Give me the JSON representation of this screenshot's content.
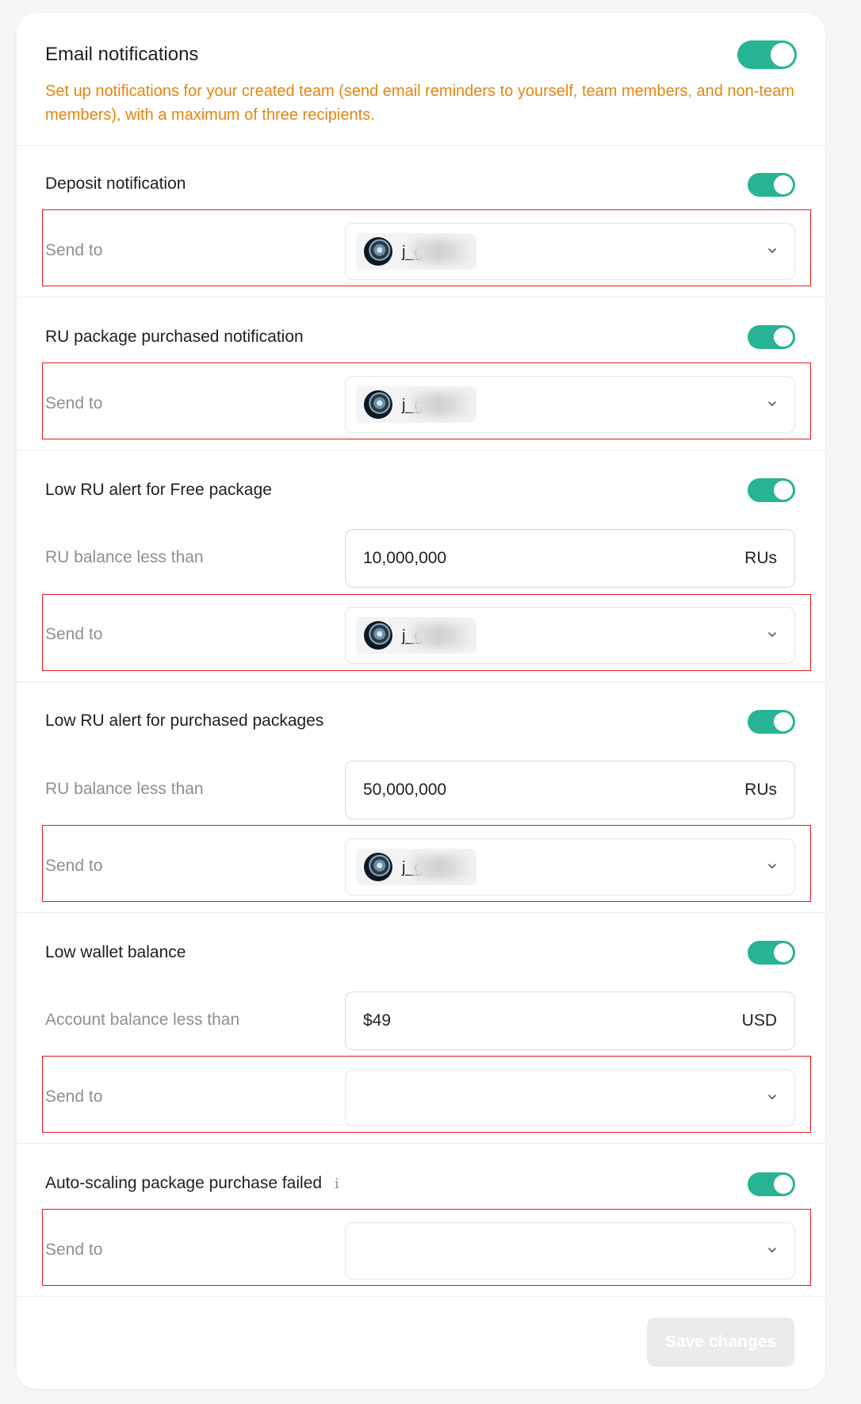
{
  "header": {
    "title": "Email notifications",
    "description": "Set up notifications for your created team (send email reminders to yourself, team members, and non-team members), with a maximum of three recipients.",
    "enabled": true
  },
  "sections": [
    {
      "title": "Deposit notification",
      "enabled": true,
      "send_to_label": "Send to",
      "recipient": "j_g"
    },
    {
      "title": "RU package purchased notification",
      "enabled": true,
      "send_to_label": "Send to",
      "recipient": "j_g"
    },
    {
      "title": "Low RU alert for Free package",
      "enabled": true,
      "threshold_label": "RU balance less than",
      "threshold_value": "10,000,000",
      "threshold_unit": "RUs",
      "send_to_label": "Send to",
      "recipient": "j_g"
    },
    {
      "title": "Low RU alert for purchased packages",
      "enabled": true,
      "threshold_label": "RU balance less than",
      "threshold_value": "50,000,000",
      "threshold_unit": "RUs",
      "send_to_label": "Send to",
      "recipient": "j_g"
    },
    {
      "title": "Low wallet balance",
      "enabled": true,
      "threshold_label": "Account balance less than",
      "threshold_value": "$49",
      "threshold_unit": "USD",
      "send_to_label": "Send to",
      "recipient": ""
    },
    {
      "title": "Auto-scaling package purchase failed",
      "enabled": true,
      "info_icon": "i",
      "send_to_label": "Send to",
      "recipient": ""
    }
  ],
  "footer": {
    "save_label": "Save changes",
    "save_enabled": false
  },
  "colors": {
    "accent": "#27b495",
    "warning_text": "#e5850f",
    "highlight_box": "#e0191c"
  }
}
